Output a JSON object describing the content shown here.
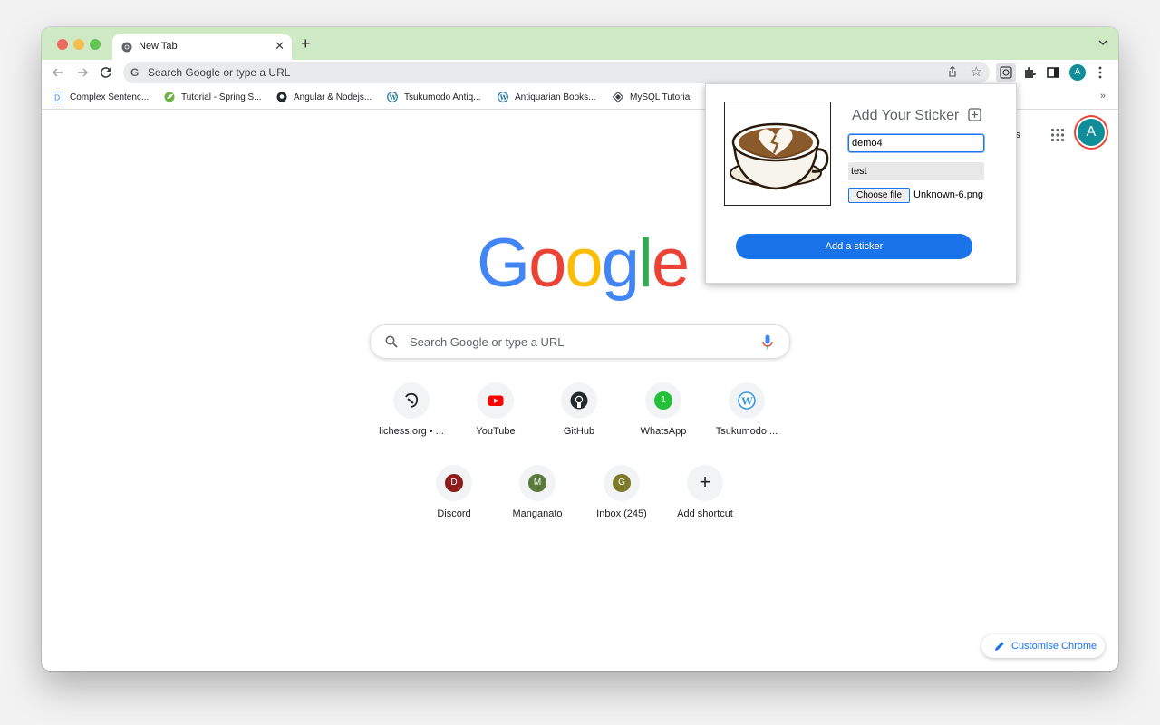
{
  "browser": {
    "tab_title": "New Tab",
    "new_tab_symbol": "+",
    "omnibox_placeholder": "Search Google or type a URL",
    "profile_initial": "A"
  },
  "bookmarks": [
    {
      "label": "Complex Sentenc...",
      "icon": "dictionary-icon"
    },
    {
      "label": "Tutorial - Spring S...",
      "icon": "spring-icon"
    },
    {
      "label": "Angular & Nodejs...",
      "icon": "github-icon"
    },
    {
      "label": "Tsukumodo Antiq...",
      "icon": "wordpress-icon"
    },
    {
      "label": "Antiquarian Books...",
      "icon": "wordpress-icon"
    },
    {
      "label": "MySQL Tutorial",
      "icon": "diamond-icon"
    }
  ],
  "bookmarks_more": "»",
  "page": {
    "header_link_partial": "ges",
    "logo": [
      "G",
      "o",
      "o",
      "g",
      "l",
      "e"
    ],
    "search_placeholder": "Search Google or type a URL",
    "customise_label": "Customise Chrome"
  },
  "shortcuts": [
    {
      "label": "lichess.org • ...",
      "icon": "lichess-icon"
    },
    {
      "label": "YouTube",
      "icon": "youtube-icon"
    },
    {
      "label": "GitHub",
      "icon": "github-icon"
    },
    {
      "label": "WhatsApp",
      "icon": "whatsapp-icon",
      "letter": "1",
      "color": "#25c03a"
    },
    {
      "label": "Tsukumodo ...",
      "icon": "wordpress-icon"
    },
    {
      "label": "Discord",
      "letter": "D",
      "color": "#8b1c1c"
    },
    {
      "label": "Manganato",
      "letter": "M",
      "color": "#5a7a3c"
    },
    {
      "label": "Inbox (245)",
      "letter": "G",
      "color": "#7d7a2a"
    },
    {
      "label": "Add shortcut",
      "icon": "plus-icon",
      "symbol": "+"
    }
  ],
  "popup": {
    "title": "Add Your Sticker",
    "name_value": "demo4",
    "desc_value": "test",
    "choose_file_label": "Choose file",
    "file_name": "Unknown-6.png",
    "submit_label": "Add a sticker",
    "sticker_image": "coffee-cup-broken-heart"
  },
  "colors": {
    "tab_strip": "#cfe9c5",
    "accent_blue": "#1a73e8",
    "google_blue": "#4285f4",
    "google_red": "#ea4335",
    "google_yellow": "#fbbc05",
    "google_green": "#34a853"
  }
}
